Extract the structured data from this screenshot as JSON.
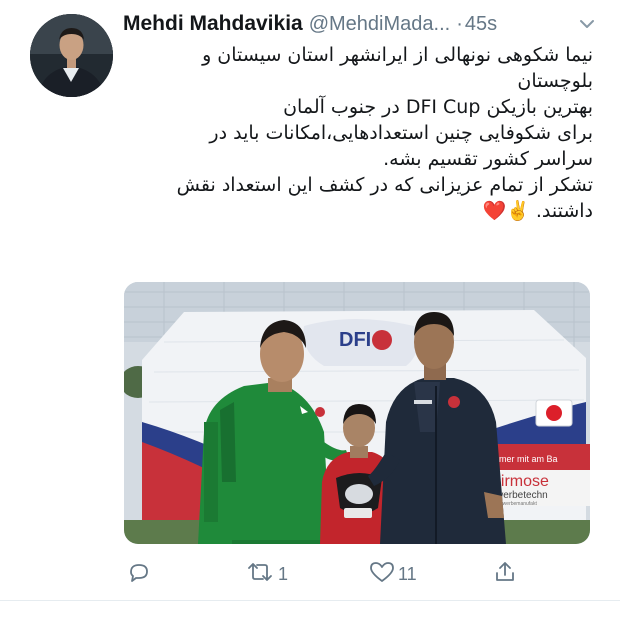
{
  "tweet": {
    "author_name": "Mehdi Mahdavikia",
    "handle": "@MehdiMada...",
    "dot": "·",
    "time": "45s",
    "text_lines": [
      "نیما شکوهی نونهالی از ایرانشهر استان سیستان و",
      "بلوچستان",
      "بهترین بازیکن DFI Cup در جنوب آلمان",
      "برای شکوفایی چنین استعدادهایی،امکانات باید در",
      "سراسر کشور تقسیم بشه.",
      "تشکر از تمام عزیزانی که در کشف این استعداد نقش",
      "داشتند. ✌️❤️"
    ],
    "photo": {
      "banner_text": "DFI",
      "sign_line1": "Immer mit am Ba",
      "sign_line2": "birmose",
      "sign_line3": "werbetechn",
      "sign_line4": "diewerbemanufakt"
    },
    "actions": {
      "reply_count": "",
      "retweet_count": "1",
      "like_count": "11"
    },
    "icons": {
      "reply": "reply-icon",
      "retweet": "retweet-icon",
      "like": "heart-icon",
      "share": "share-icon",
      "caret": "chevron-down-icon"
    },
    "colors": {
      "name": "#14171a",
      "secondary": "#657786",
      "jersey_green": "#1f8a3a",
      "jacket_navy": "#1f2a3a",
      "banner_red": "#c8313a",
      "banner_blue": "#2b3f8a"
    }
  }
}
